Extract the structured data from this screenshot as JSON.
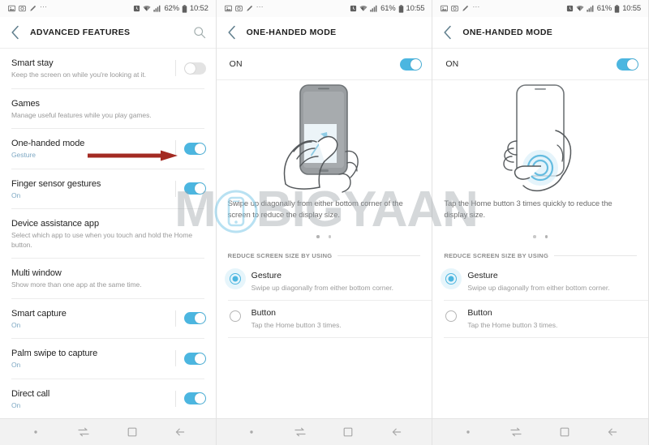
{
  "watermark": {
    "text_left": "M",
    "text_right": "BIGYAAN",
    "icon": "phone-in-circle-icon"
  },
  "panels": [
    {
      "id": "advanced-features",
      "statusbar": {
        "icons_left": [
          "image-icon",
          "screenshot-icon",
          "pen-icon",
          "more-icon"
        ],
        "icons_right": [
          "alarm-icon",
          "wifi-icon",
          "signal-icon",
          "battery-icon"
        ],
        "battery": "62%",
        "time": "10:52"
      },
      "appbar": {
        "back": "back-chevron-icon",
        "title": "ADVANCED FEATURES",
        "action": "search-icon"
      },
      "items": [
        {
          "title": "Smart stay",
          "subtitle": "Keep the screen on while you're looking at it.",
          "sub_accent": false,
          "toggle": "off",
          "has_toggle": true
        },
        {
          "title": "Games",
          "subtitle": "Manage useful features while you play games.",
          "sub_accent": false,
          "has_toggle": false
        },
        {
          "title": "One-handed mode",
          "subtitle": "Gesture",
          "sub_accent": true,
          "toggle": "on",
          "has_toggle": true,
          "annotated": true
        },
        {
          "title": "Finger sensor gestures",
          "subtitle": "On",
          "sub_accent": true,
          "toggle": "on",
          "has_toggle": true
        },
        {
          "title": "Device assistance app",
          "subtitle": "Select which app to use when you touch and hold the Home button.",
          "sub_accent": false,
          "has_toggle": false
        },
        {
          "title": "Multi window",
          "subtitle": "Show more than one app at the same time.",
          "sub_accent": false,
          "has_toggle": false
        },
        {
          "title": "Smart capture",
          "subtitle": "On",
          "sub_accent": true,
          "toggle": "on",
          "has_toggle": true
        },
        {
          "title": "Palm swipe to capture",
          "subtitle": "On",
          "sub_accent": true,
          "toggle": "on",
          "has_toggle": true
        },
        {
          "title": "Direct call",
          "subtitle": "On",
          "sub_accent": true,
          "toggle": "on",
          "has_toggle": true
        }
      ]
    },
    {
      "id": "one-handed-mode-gesture",
      "statusbar": {
        "icons_left": [
          "image-icon",
          "screenshot-icon",
          "pen-icon",
          "more-icon"
        ],
        "icons_right": [
          "alarm-icon",
          "wifi-icon",
          "signal-icon",
          "battery-icon"
        ],
        "battery": "61%",
        "time": "10:55"
      },
      "appbar": {
        "back": "back-chevron-icon",
        "title": "ONE-HANDED MODE",
        "action": null
      },
      "master": {
        "label": "ON",
        "toggle": "on"
      },
      "illustration": "hand-swipe-phone-illustration",
      "howto": "Swipe up diagonally from either bottom corner of the screen to reduce the display size.",
      "pager": {
        "count": 2,
        "active": 0
      },
      "section_label": "REDUCE SCREEN SIZE BY USING",
      "options": [
        {
          "title": "Gesture",
          "subtitle": "Swipe up diagonally from either bottom corner.",
          "selected": true
        },
        {
          "title": "Button",
          "subtitle": "Tap the Home button 3 times.",
          "selected": false
        }
      ]
    },
    {
      "id": "one-handed-mode-button",
      "statusbar": {
        "icons_left": [
          "image-icon",
          "screenshot-icon",
          "pen-icon",
          "more-icon"
        ],
        "icons_right": [
          "alarm-icon",
          "wifi-icon",
          "signal-icon",
          "battery-icon"
        ],
        "battery": "61%",
        "time": "10:55"
      },
      "appbar": {
        "back": "back-chevron-icon",
        "title": "ONE-HANDED MODE",
        "action": null
      },
      "master": {
        "label": "ON",
        "toggle": "on"
      },
      "illustration": "hand-tap-home-button-illustration",
      "howto": "Tap the Home button 3 times quickly to reduce the display size.",
      "pager": {
        "count": 2,
        "active": 1
      },
      "section_label": "REDUCE SCREEN SIZE BY USING",
      "options": [
        {
          "title": "Gesture",
          "subtitle": "Swipe up diagonally from either bottom corner.",
          "selected": true
        },
        {
          "title": "Button",
          "subtitle": "Tap the Home button 3 times.",
          "selected": false
        }
      ]
    }
  ],
  "navbar": {
    "icons": [
      "dot-icon",
      "recents-icon",
      "home-icon",
      "back-arrow-icon"
    ]
  },
  "colors": {
    "toggle_on": "#4cb6e0",
    "accent_text": "#7fa9c4",
    "annotation_arrow": "#a32a22"
  }
}
